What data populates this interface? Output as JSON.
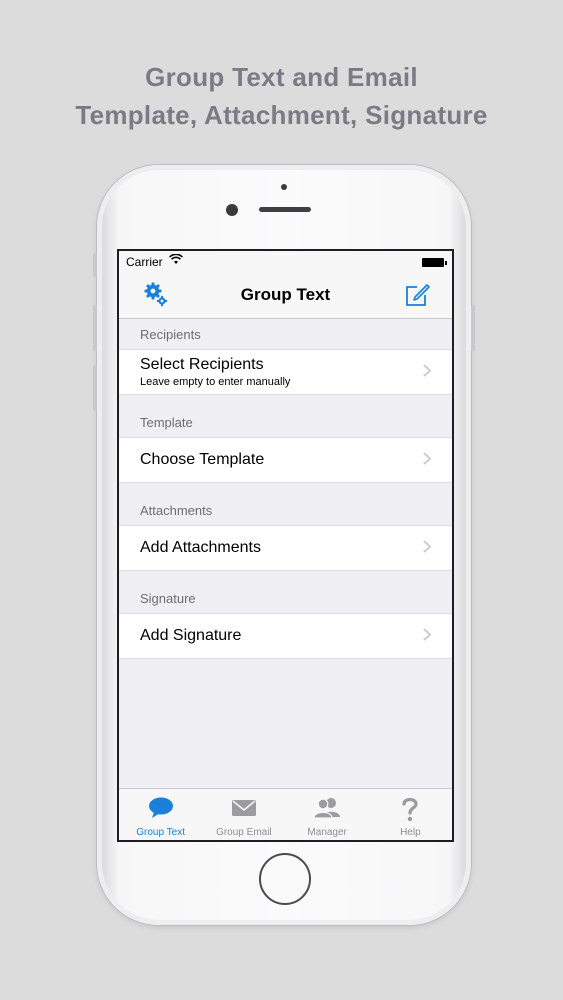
{
  "promo": {
    "line1": "Group Text and Email",
    "line2": "Template, Attachment, Signature"
  },
  "status_bar": {
    "carrier": "Carrier"
  },
  "nav": {
    "title": "Group Text",
    "left_icon": "gear-icon",
    "right_icon": "compose-icon"
  },
  "sections": [
    {
      "header": "Recipients",
      "cell": {
        "label": "Select Recipients",
        "subtitle": "Leave empty to enter manually"
      }
    },
    {
      "header": "Template",
      "cell": {
        "label": "Choose Template"
      }
    },
    {
      "header": "Attachments",
      "cell": {
        "label": "Add Attachments"
      }
    },
    {
      "header": "Signature",
      "cell": {
        "label": "Add Signature"
      }
    }
  ],
  "tabs": [
    {
      "label": "Group Text",
      "icon": "speech-bubble-icon",
      "active": true
    },
    {
      "label": "Group Email",
      "icon": "envelope-icon",
      "active": false
    },
    {
      "label": "Manager",
      "icon": "people-icon",
      "active": false
    },
    {
      "label": "Help",
      "icon": "question-icon",
      "active": false
    }
  ],
  "colors": {
    "accent": "#1a80d9",
    "background": "#dcdcdd",
    "headline": "#7b7b85"
  }
}
